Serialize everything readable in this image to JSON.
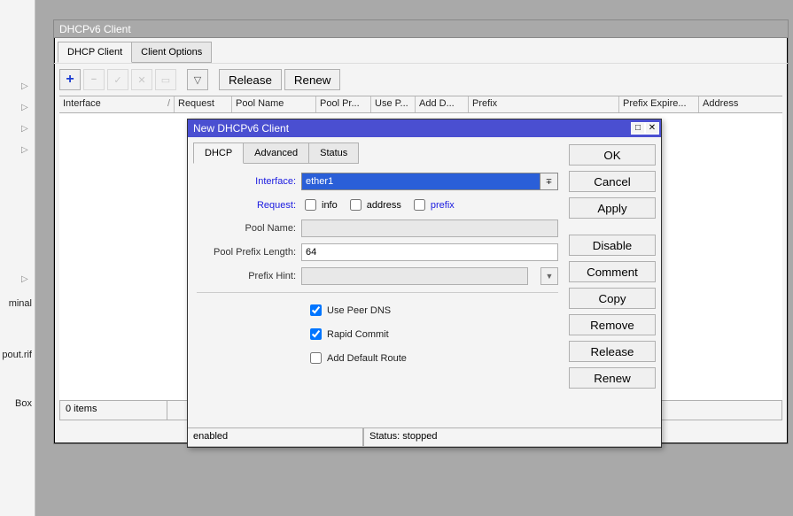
{
  "sidebar": {
    "labels": [
      "minal",
      "pout.rif",
      "Box"
    ]
  },
  "mainWindow": {
    "title": "DHCPv6 Client",
    "tabs": [
      "DHCP Client",
      "Client Options"
    ],
    "toolbar": {
      "release": "Release",
      "renew": "Renew"
    },
    "columns": {
      "interface": "Interface",
      "request": "Request",
      "poolName": "Pool Name",
      "poolPr": "Pool Pr...",
      "useP": "Use P...",
      "addD": "Add D...",
      "prefix": "Prefix",
      "prefixExpire": "Prefix Expire...",
      "address": "Address"
    },
    "status": "0 items"
  },
  "modal": {
    "title": "New DHCPv6 Client",
    "tabs": [
      "DHCP",
      "Advanced",
      "Status"
    ],
    "labels": {
      "interface": "Interface:",
      "request": "Request:",
      "poolName": "Pool Name:",
      "poolPrefixLength": "Pool Prefix Length:",
      "prefixHint": "Prefix Hint:"
    },
    "values": {
      "interface": "ether1",
      "poolPrefixLength": "64",
      "poolName": "",
      "prefixHint": ""
    },
    "requestOpts": {
      "info": "info",
      "address": "address",
      "prefix": "prefix"
    },
    "checks": {
      "usePeerDNS": "Use Peer DNS",
      "rapidCommit": "Rapid Commit",
      "addDefaultRoute": "Add Default Route"
    },
    "buttons": {
      "ok": "OK",
      "cancel": "Cancel",
      "apply": "Apply",
      "disable": "Disable",
      "comment": "Comment",
      "copy": "Copy",
      "remove": "Remove",
      "release": "Release",
      "renew": "Renew"
    },
    "status": {
      "enabled": "enabled",
      "running": "Status: stopped"
    }
  }
}
